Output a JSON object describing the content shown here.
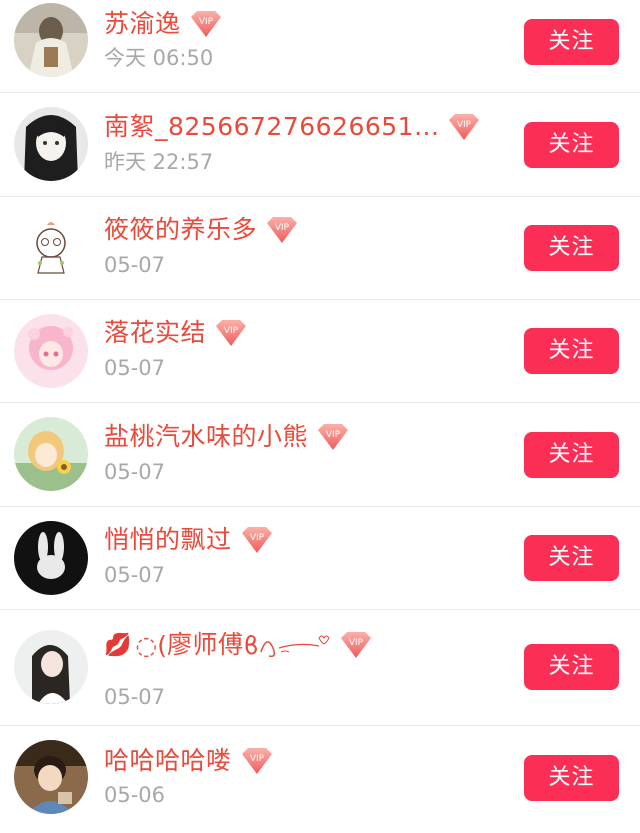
{
  "follow_label": "关注",
  "vip_label": "VIP",
  "users": [
    {
      "name": "苏渝逸",
      "time": "今天 06:50"
    },
    {
      "name": "南絮_825667276626651...",
      "time": "昨天 22:57"
    },
    {
      "name": "筱筱的养乐多",
      "time": "05-07"
    },
    {
      "name": "落花实结",
      "time": "05-07"
    },
    {
      "name": "盐桃汽水味的小熊",
      "time": "05-07"
    },
    {
      "name": "悄悄的飘过",
      "time": "05-07"
    },
    {
      "name_prefix": "💋",
      "name_lead": "◌(",
      "name": "廖师傅",
      "name_suffix": "ϐ",
      "time": "05-07"
    },
    {
      "name": "哈哈哈哈喽",
      "time": "05-06"
    }
  ],
  "colors": {
    "name": "#ea4a3a",
    "time": "#a8a8a8",
    "button": "#fb2f56",
    "vip_badge": "#f06a6a"
  }
}
